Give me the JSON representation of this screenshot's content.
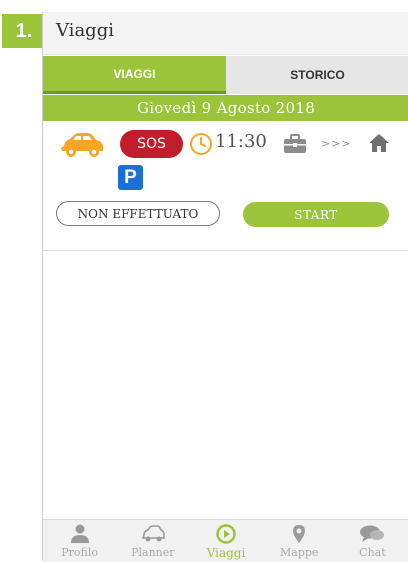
{
  "step_badge": "1.",
  "header": {
    "title": "Viaggi"
  },
  "tabs": [
    {
      "label": "VIAGGI",
      "active": true
    },
    {
      "label": "STORICO",
      "active": false
    }
  ],
  "date": "Giovedì 9 Agosto 2018",
  "trip": {
    "vehicle_icon": "car-icon",
    "sos_label": "SOS",
    "time": "11:30",
    "from_icon": "briefcase-icon",
    "arrows": ">>>",
    "to_icon": "home-icon",
    "parking_label": "P",
    "status_label": "NON EFFETTUATO",
    "start_label": "START"
  },
  "bottom_nav": [
    {
      "label": "Profilo",
      "icon": "person-icon",
      "active": false
    },
    {
      "label": "Planner",
      "icon": "car-icon",
      "active": false
    },
    {
      "label": "Viaggi",
      "icon": "play-icon",
      "active": true
    },
    {
      "label": "Mappe",
      "icon": "map-pin-icon",
      "active": false
    },
    {
      "label": "Chat",
      "icon": "chat-icon",
      "active": false
    }
  ],
  "colors": {
    "accent": "#9bc43a",
    "sos": "#c21d2c",
    "car": "#f5a623",
    "parking": "#1d6fd6",
    "nav_inactive": "#aaaaaa"
  }
}
